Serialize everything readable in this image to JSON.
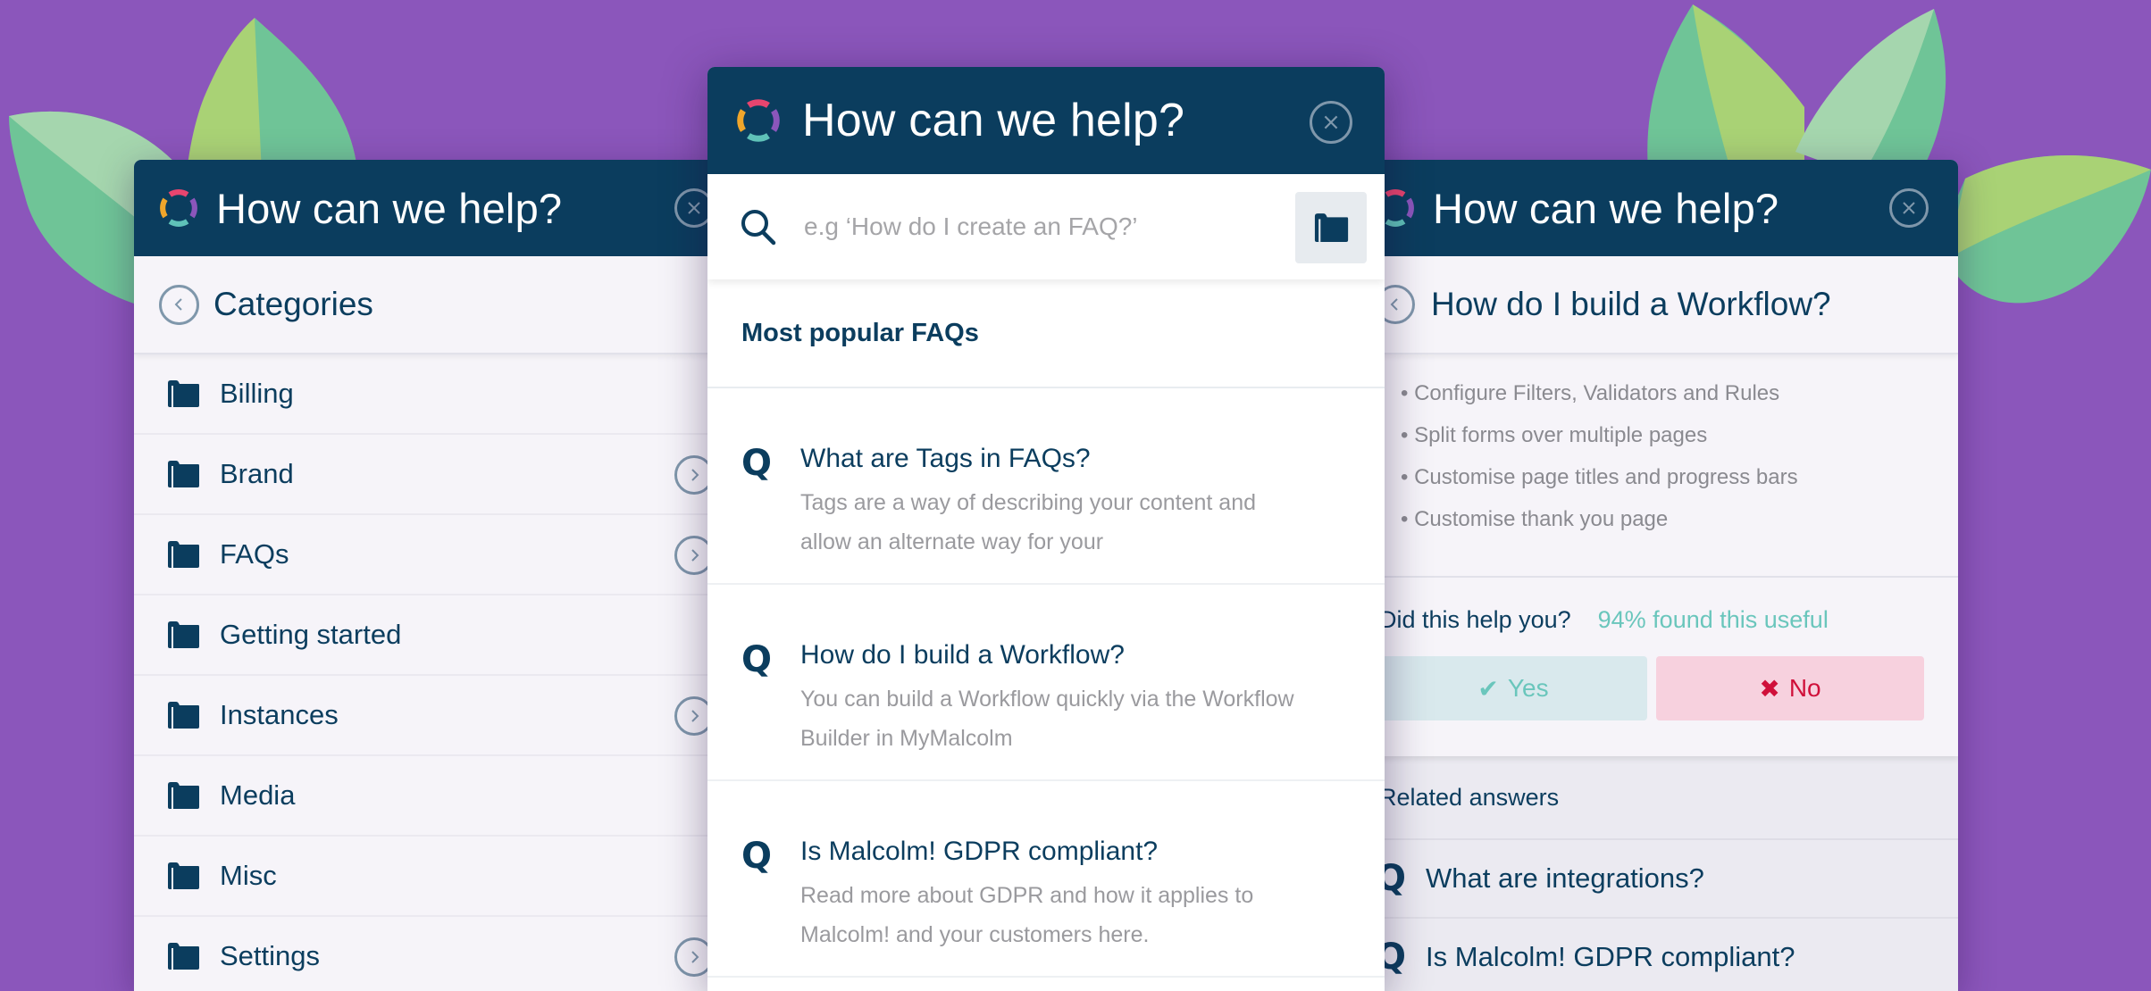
{
  "theme": {
    "background": "#8b56bb",
    "header": "#0b3d5e",
    "accent_teal": "#6ac6bc",
    "accent_red": "#d0103a",
    "logo_colors": [
      "#e8456f",
      "#8b56bb",
      "#5fc2b8",
      "#f0a62b"
    ]
  },
  "left_panel": {
    "header_title": "How can we help?",
    "close_icon": "close-icon",
    "subheader_title": "Categories",
    "categories": [
      {
        "label": "Billing",
        "has_children": false
      },
      {
        "label": "Brand",
        "has_children": true
      },
      {
        "label": "FAQs",
        "has_children": true
      },
      {
        "label": "Getting started",
        "has_children": false
      },
      {
        "label": "Instances",
        "has_children": true
      },
      {
        "label": "Media",
        "has_children": false
      },
      {
        "label": "Misc",
        "has_children": false
      },
      {
        "label": "Settings",
        "has_children": true
      }
    ]
  },
  "center_panel": {
    "header_title": "How can we help?",
    "search": {
      "placeholder": "e.g ‘How do I create an FAQ?’",
      "value": ""
    },
    "section_title": "Most popular FAQs",
    "faqs": [
      {
        "title": "What are Tags in FAQs?",
        "description": "Tags are a way of describing your content and allow an alternate way for your"
      },
      {
        "title": "How do I build a Workflow?",
        "description": "You can build a Workflow quickly via the Workflow Builder in MyMalcolm"
      },
      {
        "title": "Is Malcolm! GDPR compliant?",
        "description": "Read more about GDPR and how it applies to Malcolm! and your customers here."
      }
    ]
  },
  "right_panel": {
    "header_title": "How can we help?",
    "article_title": "How do I build a Workflow?",
    "bullets": [
      "• Configure Filters, Validators and Rules",
      "• Split forms over multiple pages",
      "• Customise page titles and progress bars",
      "• Customise thank you page"
    ],
    "feedback": {
      "question": "Did this help you?",
      "stat": "94% found this useful",
      "yes_label": "Yes",
      "no_label": "No"
    },
    "related": {
      "title": "Related answers",
      "items": [
        {
          "label": "What are integrations?"
        },
        {
          "label": "Is Malcolm! GDPR compliant?"
        }
      ]
    }
  },
  "glyphs": {
    "q": "Q",
    "check": "✔",
    "cross": "✖"
  }
}
